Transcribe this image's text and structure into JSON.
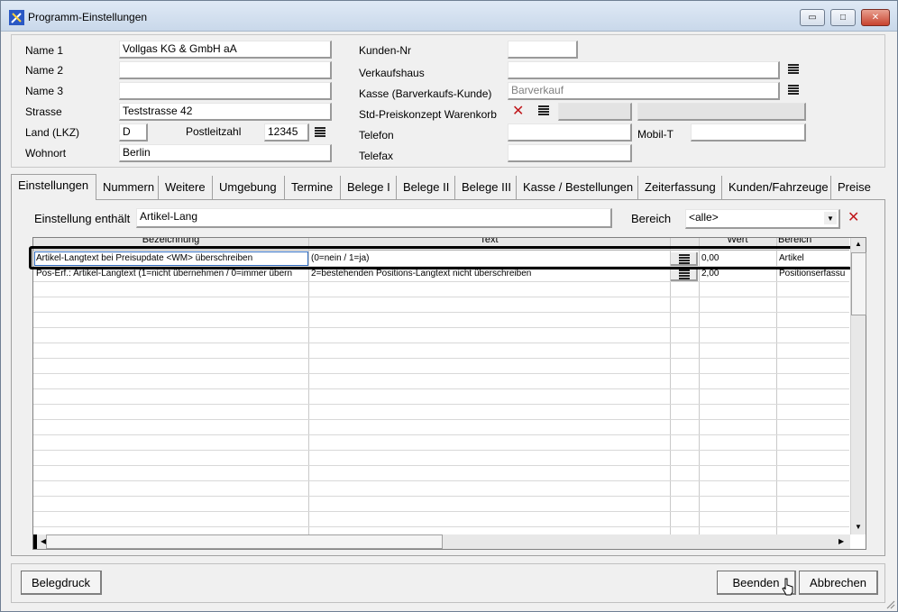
{
  "window": {
    "title": "Programm-Einstellungen",
    "controls": {
      "minimize": "▭",
      "maximize": "□",
      "close": "✕"
    }
  },
  "customer": {
    "name1_label": "Name 1",
    "name1_value": "Vollgas KG & GmbH aA",
    "name2_label": "Name 2",
    "name2_value": "",
    "name3_label": "Name 3",
    "name3_value": "",
    "street_label": "Strasse",
    "street_value": "Teststrasse 42",
    "country_label": "Land (LKZ)",
    "country_value": "D",
    "zip_label": "Postleitzahl",
    "zip_value": "12345",
    "city_label": "Wohnort",
    "city_value": "Berlin",
    "kundennr_label": "Kunden-Nr",
    "kundennr_value": "",
    "verkaufshaus_label": "Verkaufshaus",
    "verkaufshaus_value": "",
    "kasse_label": "Kasse (Barverkaufs-Kunde)",
    "kasse_value": "Barverkauf",
    "preiskonzept_label": "Std-Preiskonzept Warenkorb",
    "telefon_label": "Telefon",
    "telefon_value": "",
    "mobil_label": "Mobil-T",
    "mobil_value": "",
    "telefax_label": "Telefax",
    "telefax_value": ""
  },
  "tabs": [
    "Einstellungen",
    "Nummern",
    "Weitere",
    "Umgebung",
    "Termine",
    "Belege I",
    "Belege II",
    "Belege III",
    "Kasse / Bestellungen",
    "Zeiterfassung",
    "Kunden/Fahrzeuge",
    "Preise"
  ],
  "active_tab": "Einstellungen",
  "filter": {
    "contains_label": "Einstellung enthält",
    "contains_value": "Artikel-Lang",
    "bereich_label": "Bereich",
    "bereich_value": "<alle>"
  },
  "grid": {
    "columns": [
      "Bezeichnung",
      "Text",
      "",
      "Wert",
      "Bereich"
    ],
    "rows": [
      {
        "bezeichnung": "Artikel-Langtext bei Preisupdate <WM> überschreiben",
        "text": "(0=nein / 1=ja)",
        "wert": "0,00",
        "bereich": "Artikel"
      },
      {
        "bezeichnung": "Pos-Erf.: Artikel-Langtext (1=nicht übernehmen / 0=immer übern",
        "text": "2=bestehenden Positions-Langtext nicht überschreiben",
        "wert": "2,00",
        "bereich": "Positionserfassu"
      }
    ]
  },
  "buttons": {
    "belegdruck": "Belegdruck",
    "beenden": "Beenden",
    "abbrechen": "Abbrechen"
  },
  "colors": {
    "accent_red": "#c0181c",
    "selection_blue": "#2f6bbf"
  }
}
